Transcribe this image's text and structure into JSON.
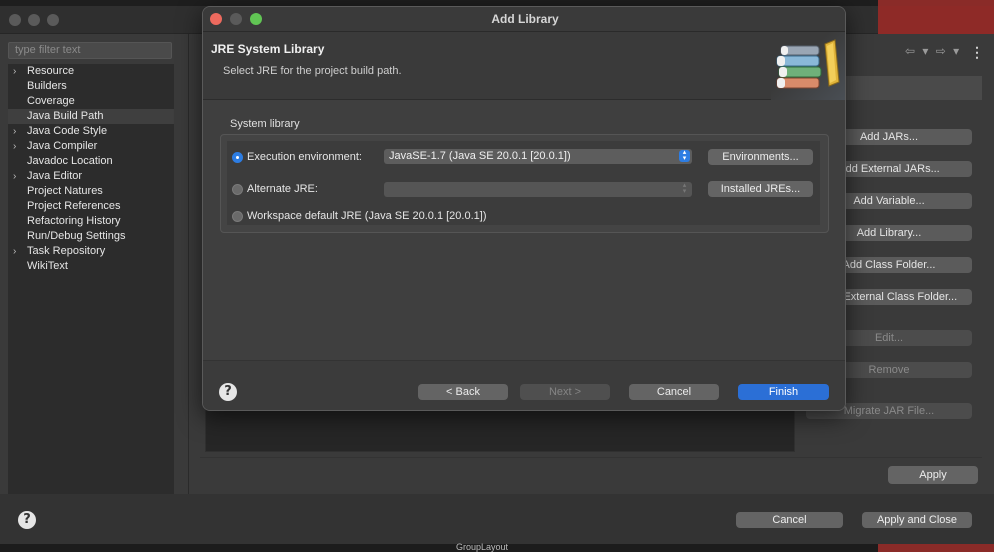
{
  "background_window": {
    "filter_placeholder": "type filter text",
    "tree_items": [
      {
        "label": "Resource",
        "expandable": true,
        "selected": false
      },
      {
        "label": "Builders",
        "expandable": false,
        "selected": false
      },
      {
        "label": "Coverage",
        "expandable": false,
        "selected": false
      },
      {
        "label": "Java Build Path",
        "expandable": false,
        "selected": true
      },
      {
        "label": "Java Code Style",
        "expandable": true,
        "selected": false
      },
      {
        "label": "Java Compiler",
        "expandable": true,
        "selected": false
      },
      {
        "label": "Javadoc Location",
        "expandable": false,
        "selected": false
      },
      {
        "label": "Java Editor",
        "expandable": true,
        "selected": false
      },
      {
        "label": "Project Natures",
        "expandable": false,
        "selected": false
      },
      {
        "label": "Project References",
        "expandable": false,
        "selected": false
      },
      {
        "label": "Refactoring History",
        "expandable": false,
        "selected": false
      },
      {
        "label": "Run/Debug Settings",
        "expandable": false,
        "selected": false
      },
      {
        "label": "Task Repository",
        "expandable": true,
        "selected": false
      },
      {
        "label": "WikiText",
        "expandable": false,
        "selected": false
      }
    ],
    "side_buttons": {
      "add_jars": "Add JARs...",
      "add_external_jars": "Add External JARs...",
      "add_variable": "Add Variable...",
      "add_library": "Add Library...",
      "add_class_folder": "Add Class Folder...",
      "add_external_class_folder": "Add External Class Folder...",
      "edit": "Edit...",
      "remove": "Remove",
      "migrate_jar": "Migrate JAR File..."
    },
    "apply_label": "Apply",
    "cancel_label": "Cancel",
    "apply_and_close_label": "Apply and Close",
    "bottom_strip_text": "GroupLayout"
  },
  "dialog": {
    "window_title": "Add Library",
    "header_title": "JRE System Library",
    "header_description": "Select JRE for the project build path.",
    "group_label": "System library",
    "options": {
      "execution_env": {
        "label": "Execution environment:",
        "selected": true,
        "value": "JavaSE-1.7 (Java SE 20.0.1 [20.0.1])",
        "button": "Environments..."
      },
      "alternate_jre": {
        "label": "Alternate JRE:",
        "selected": false,
        "value": "",
        "button": "Installed JREs..."
      },
      "workspace_default": {
        "label": "Workspace default JRE (Java SE 20.0.1 [20.0.1])",
        "selected": false
      }
    },
    "footer": {
      "back": "< Back",
      "next": "Next >",
      "cancel": "Cancel",
      "finish": "Finish"
    }
  },
  "colors": {
    "accent_blue": "#2d7de3",
    "primary_button": "#2b6fd6",
    "close_light": "#ed6a5e",
    "max_light": "#61c554"
  },
  "icons": {
    "help": "question-mark",
    "books": "library-books",
    "chevron": "chevron-right"
  }
}
